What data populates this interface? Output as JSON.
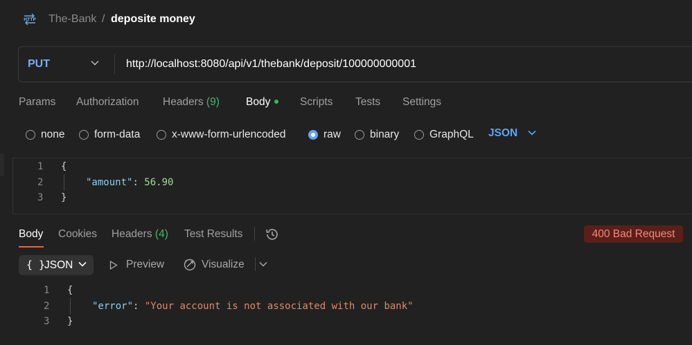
{
  "header": {
    "collection": "The-Bank",
    "separator": "/",
    "request_name": "deposite money",
    "icon_label": "HTTP"
  },
  "url_bar": {
    "method": "PUT",
    "url": "http://localhost:8080/api/v1/thebank/deposit/100000000001"
  },
  "request_tabs": [
    {
      "label": "Params"
    },
    {
      "label": "Authorization"
    },
    {
      "label": "Headers",
      "count": "(9)"
    },
    {
      "label": "Body",
      "active": true
    },
    {
      "label": "Scripts"
    },
    {
      "label": "Tests"
    },
    {
      "label": "Settings"
    }
  ],
  "body_types": [
    {
      "label": "none",
      "checked": false
    },
    {
      "label": "form-data",
      "checked": false
    },
    {
      "label": "x-www-form-urlencoded",
      "checked": false
    },
    {
      "label": "raw",
      "checked": true
    },
    {
      "label": "binary",
      "checked": false
    },
    {
      "label": "GraphQL",
      "checked": false
    }
  ],
  "raw_format": "JSON",
  "request_body": {
    "line_numbers": [
      "1",
      "2",
      "3"
    ],
    "open_brace": "{",
    "key": "\"amount\"",
    "colon": ": ",
    "value": "56.90",
    "close_brace": "}"
  },
  "response_tabs": [
    {
      "label": "Body",
      "active": true
    },
    {
      "label": "Cookies"
    },
    {
      "label": "Headers",
      "count": "(4)"
    },
    {
      "label": "Test Results"
    }
  ],
  "status": {
    "text": "400 Bad Request",
    "color": "#f08a7a",
    "background": "#5b1f1a"
  },
  "response_toolbar": {
    "format_braces": "{ }",
    "format_label": "JSON",
    "preview_label": "Preview",
    "visualize_label": "Visualize"
  },
  "response_body": {
    "line_numbers": [
      "1",
      "2",
      "3"
    ],
    "open_brace": "{",
    "key": "\"error\"",
    "colon": ": ",
    "value": "\"Your account is not associated with our bank\"",
    "close_brace": "}"
  },
  "colors": {
    "accent_blue": "#5ea5f5",
    "active_tab_underline": "#e8663a",
    "body_dot": "#2fbb5c"
  }
}
